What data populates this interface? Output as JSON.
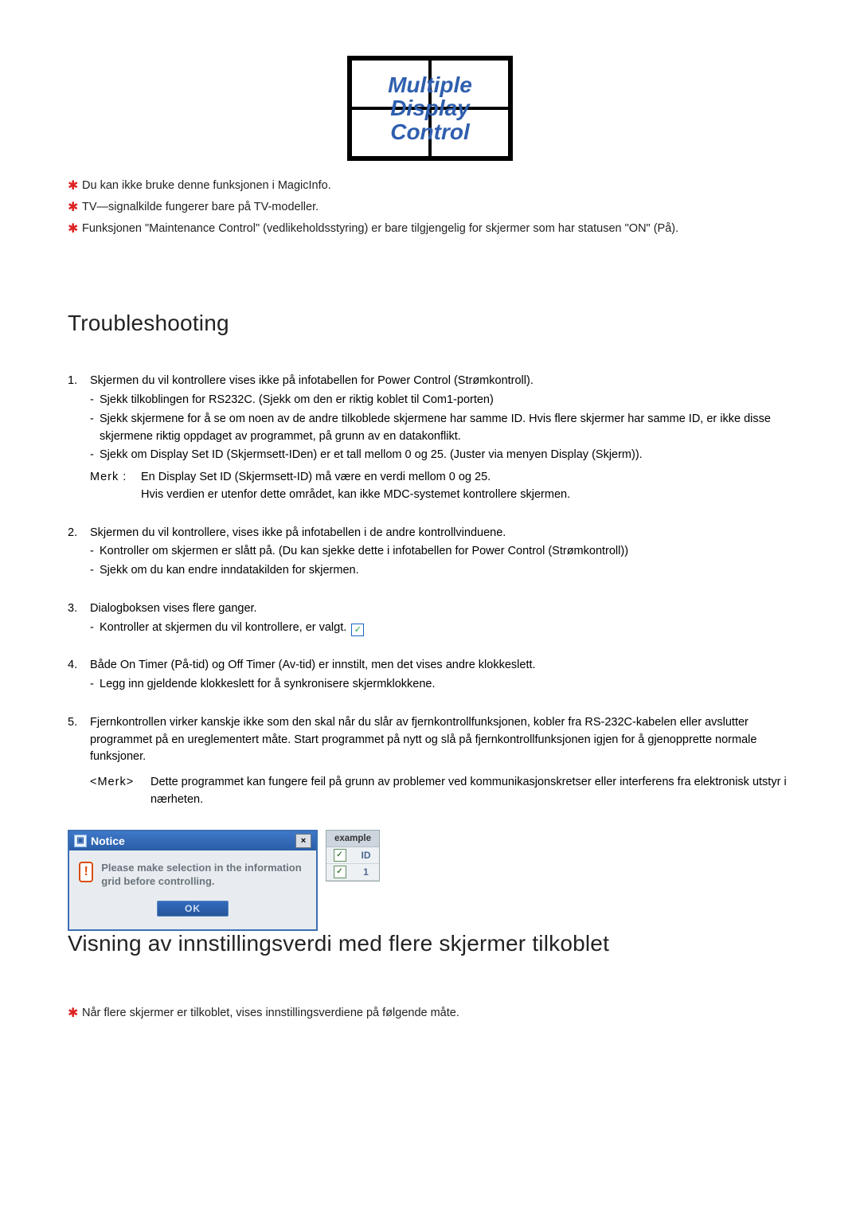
{
  "logo": {
    "line1": "Multiple",
    "line2": "Display",
    "line3": "Control"
  },
  "top_stars": [
    "Du kan ikke bruke denne funksjonen i MagicInfo.",
    "TV—signalkilde fungerer bare på TV-modeller.",
    "Funksjonen \"Maintenance Control\" (vedlikeholdsstyring) er bare tilgjengelig for skjermer som har statusen \"ON\" (På)."
  ],
  "heading1": "Troubleshooting",
  "items": [
    {
      "num": "1.",
      "lead": "Skjermen du vil kontrollere vises ikke på infotabellen for Power Control (Strømkontroll).",
      "subs": [
        "Sjekk tilkoblingen for RS232C. (Sjekk om den er riktig koblet til Com1-porten)",
        "Sjekk skjermene for å se om noen av de andre tilkoblede skjermene har samme ID. Hvis flere skjermer har samme ID, er ikke disse skjermene riktig oppdaget av programmet, på grunn av en datakonflikt.",
        "Sjekk om Display Set ID (Skjermsett-IDen) er et tall mellom 0 og 25. (Juster via menyen Display (Skjerm))."
      ],
      "merk_label": "Merk :",
      "merk_text": "En Display Set ID (Skjermsett-ID) må være en verdi mellom 0 og 25.\nHvis verdien er utenfor dette området, kan ikke MDC-systemet kontrollere skjermen."
    },
    {
      "num": "2.",
      "lead": "Skjermen du vil kontrollere, vises ikke på infotabellen i de andre kontrollvinduene.",
      "subs": [
        "Kontroller om skjermen er slått på. (Du kan sjekke dette i infotabellen for Power Control (Strømkontroll))",
        "Sjekk om du kan endre inndatakilden for skjermen."
      ]
    },
    {
      "num": "3.",
      "lead": "Dialogboksen vises flere ganger.",
      "subs_check": "Kontroller at skjermen du vil kontrollere, er valgt."
    },
    {
      "num": "4.",
      "lead": "Både On Timer (På-tid) og Off Timer (Av-tid) er innstilt, men det vises andre klokkeslett.",
      "subs": [
        "Legg inn gjeldende klokkeslett for å synkronisere skjermklokkene."
      ]
    },
    {
      "num": "5.",
      "lead": "Fjernkontrollen virker kanskje ikke som den skal når du slår av fjernkontrollfunksjonen, kobler fra RS-232C-kabelen eller avslutter programmet på en ureglementert måte. Start programmet på nytt og slå på fjernkontrollfunksjonen igjen for å gjenopprette normale funksjoner.",
      "note_label": "<Merk>",
      "note_text": "Dette programmet kan fungere feil på grunn av problemer ved kommunikasjonskretser eller interferens fra elektronisk utstyr i nærheten."
    }
  ],
  "dialog": {
    "title": "Notice",
    "message": "Please make selection in the information grid before controlling.",
    "ok": "OK",
    "close": "×"
  },
  "side_panel": {
    "head": "example",
    "col_check": "✓",
    "col_id": "ID",
    "row_check": "✓",
    "row_id": "1"
  },
  "heading2": "Visning av innstillingsverdi med flere skjermer tilkoblet",
  "bottom_star": "Når flere skjermer er tilkoblet, vises innstillingsverdiene på følgende måte."
}
